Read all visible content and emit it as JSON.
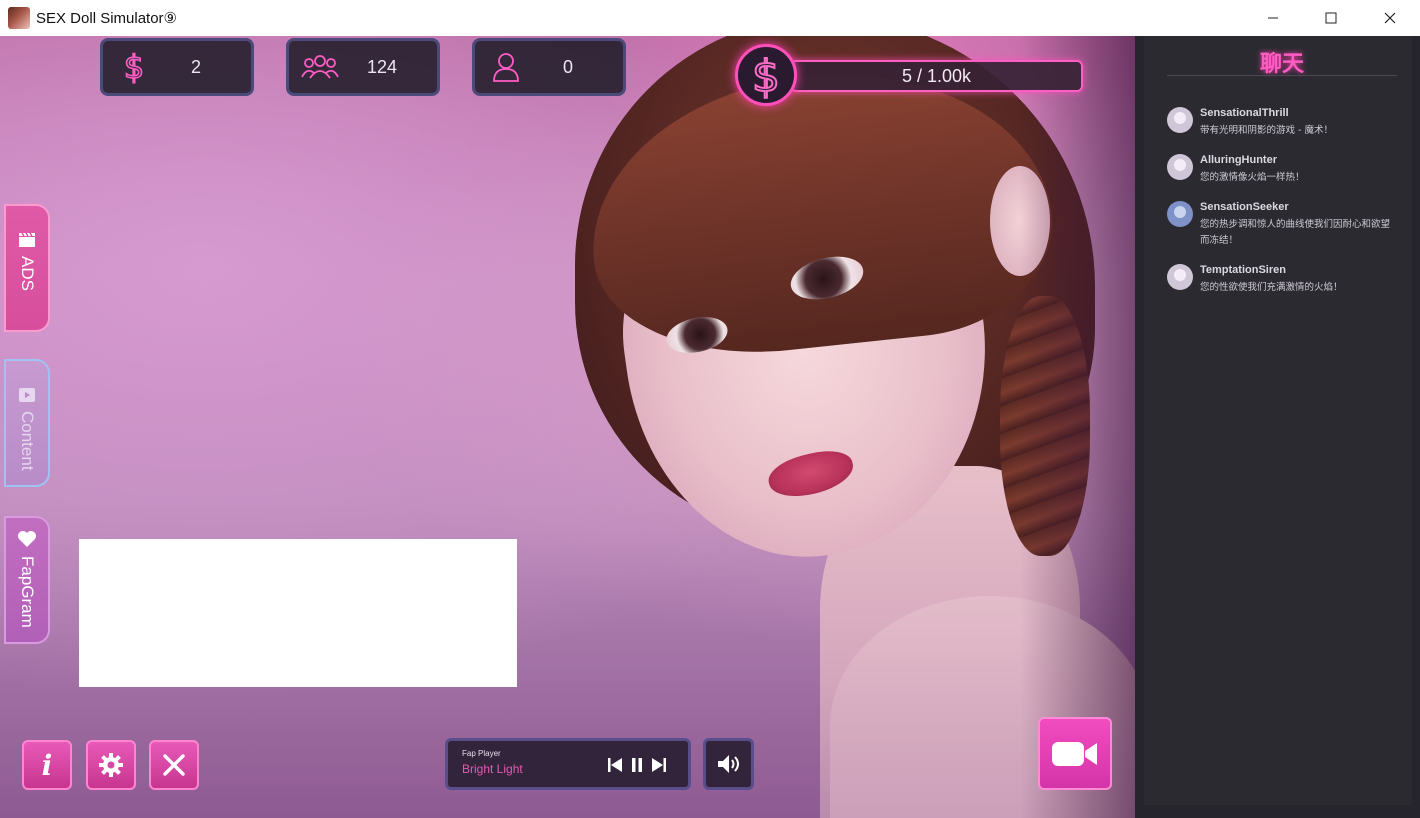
{
  "window": {
    "title": "SEX Doll Simulator⑨",
    "controls": {
      "minimize": "—",
      "maximize": "☐",
      "close": "✕"
    }
  },
  "stats": {
    "money": {
      "icon": "dollar-icon",
      "value": "2"
    },
    "followers": {
      "icon": "group-icon",
      "value": "124"
    },
    "viewers": {
      "icon": "user-icon",
      "value": "0"
    }
  },
  "goal": {
    "icon": "dollar-coin-icon",
    "text": "5 / 1.00k",
    "current": 5,
    "target": 1000,
    "progress": 0.005
  },
  "side_tabs": [
    {
      "label": "ADS",
      "icon": "clapperboard-icon"
    },
    {
      "label": "Content",
      "icon": "play-video-icon"
    },
    {
      "label": "FapGram",
      "icon": "heart-icon"
    }
  ],
  "bottom_buttons": {
    "info_glyph": "i",
    "settings_icon": "gear-icon",
    "close_icon": "close-icon"
  },
  "player": {
    "name": "Fap Player",
    "track": "Bright Light",
    "controls": [
      "previous-icon",
      "pause-icon",
      "next-icon"
    ],
    "volume_icon": "speaker-icon"
  },
  "camera_icon": "video-camera-icon",
  "chat": {
    "title": "聊天",
    "messages": [
      {
        "user": "SensationalThrill",
        "text": "带有光明和阴影的游戏 - 魔术！",
        "avatar": "female"
      },
      {
        "user": "AlluringHunter",
        "text": "您的激情像火焰一样热！",
        "avatar": "female"
      },
      {
        "user": "SensationSeeker",
        "text": "您的热步调和惊人的曲线使我们因耐心和欲望而冻结！",
        "avatar": "male"
      },
      {
        "user": "TemptationSiren",
        "text": "您的性欲使我们充满激情的火焰！",
        "avatar": "female"
      }
    ]
  },
  "colors": {
    "accent_pink": "#ff4fb8",
    "panel_dark": "#26242c",
    "stat_border": "#4c4a7a"
  }
}
